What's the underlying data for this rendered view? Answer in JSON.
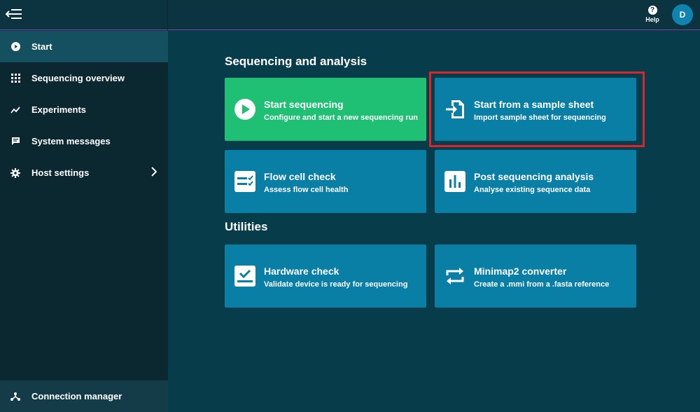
{
  "topbar": {
    "help_label": "Help",
    "avatar_initial": "D"
  },
  "sidebar": {
    "items": [
      {
        "label": "Start",
        "icon": "play-circle-icon"
      },
      {
        "label": "Sequencing overview",
        "icon": "grid-icon"
      },
      {
        "label": "Experiments",
        "icon": "trend-icon"
      },
      {
        "label": "System messages",
        "icon": "chat-icon"
      },
      {
        "label": "Host settings",
        "icon": "gear-icon"
      }
    ],
    "footer": {
      "label": "Connection manager",
      "icon": "network-icon"
    }
  },
  "sections": {
    "sequencing": "Sequencing and analysis",
    "utilities": "Utilities"
  },
  "cards": [
    {
      "title": "Start sequencing",
      "desc": "Configure and start a new sequencing run",
      "icon": "play-circle-icon",
      "color": "#1fbf74"
    },
    {
      "title": "Start from a sample sheet",
      "desc": "Import sample sheet for sequencing",
      "icon": "import-icon",
      "color": "#0a7fa5"
    },
    {
      "title": "Flow cell check",
      "desc": "Assess flow cell health",
      "icon": "checklist-icon",
      "color": "#0a7fa5"
    },
    {
      "title": "Post sequencing analysis",
      "desc": "Analyse existing sequence data",
      "icon": "bar-chart-icon",
      "color": "#0a7fa5"
    },
    {
      "title": "Hardware check",
      "desc": "Validate device is ready for sequencing",
      "icon": "hardware-check-icon",
      "color": "#0a7fa5"
    },
    {
      "title": "Minimap2 converter",
      "desc": "Create a .mmi from a .fasta reference",
      "icon": "swap-arrows-icon",
      "color": "#0a7fa5"
    }
  ],
  "colors": {
    "highlight": "#d8262f",
    "accent": "#7b3fa0"
  }
}
